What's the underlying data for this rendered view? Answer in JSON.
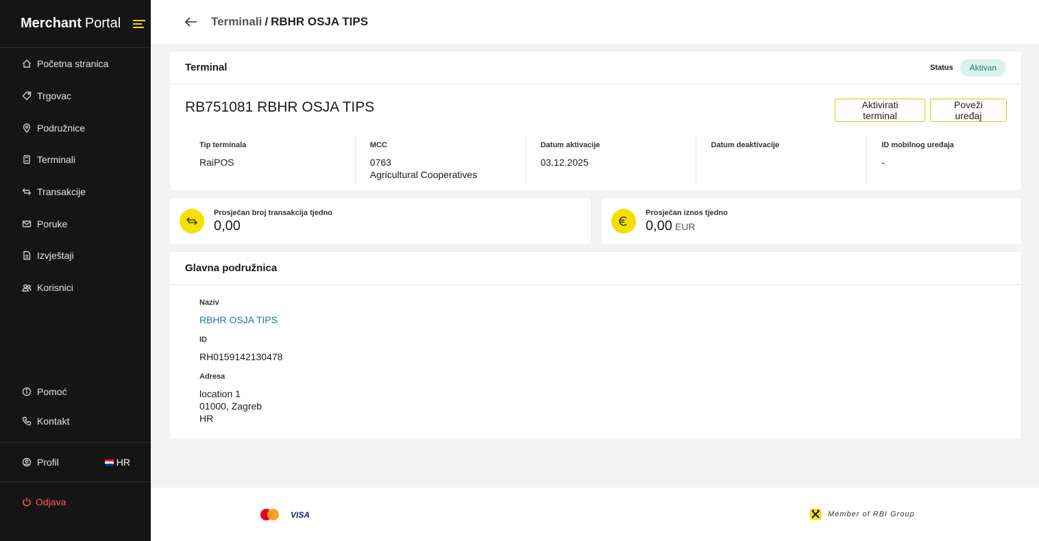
{
  "app": {
    "brand_bold": "Merchant",
    "brand_light": "Portal"
  },
  "sidebar": {
    "items": [
      {
        "label": "Početna stranica",
        "icon": "home-icon"
      },
      {
        "label": "Trgovac",
        "icon": "tag-icon"
      },
      {
        "label": "Podružnice",
        "icon": "location-pin-icon"
      },
      {
        "label": "Terminali",
        "icon": "terminal-icon"
      },
      {
        "label": "Transakcije",
        "icon": "transfer-arrows-icon"
      },
      {
        "label": "Poruke",
        "icon": "mail-icon"
      },
      {
        "label": "Izvještaji",
        "icon": "document-icon"
      },
      {
        "label": "Korisnici",
        "icon": "users-icon"
      }
    ],
    "bottom_items": [
      {
        "label": "Pomoć",
        "icon": "info-icon"
      },
      {
        "label": "Kontakt",
        "icon": "phone-icon"
      }
    ],
    "profile_label": "Profil",
    "language": "HR",
    "logout_label": "Odjava"
  },
  "header": {
    "breadcrumb_link": "Terminali",
    "breadcrumb_sep": "/",
    "breadcrumb_current": "RBHR OSJA TIPS"
  },
  "terminal": {
    "section_title": "Terminal",
    "status_label": "Status",
    "status_value": "Aktivan",
    "title": "RB751081 RBHR OSJA TIPS",
    "activate_button": "Aktivirati terminal",
    "connect_button": "Poveži uređaj",
    "fields": [
      {
        "label": "Tip terminala",
        "value": "RaiPOS",
        "value2": ""
      },
      {
        "label": "MCC",
        "value": "0763",
        "value2": "Agricultural Cooperatives"
      },
      {
        "label": "Datum aktivacije",
        "value": "03.12.2025",
        "value2": ""
      },
      {
        "label": "Datum deaktivacije",
        "value": "",
        "value2": ""
      },
      {
        "label": "ID mobilnog uređaja",
        "value": "-",
        "value2": ""
      }
    ]
  },
  "stats": {
    "transactions_label": "Prosječan broj transakcija tjedno",
    "transactions_value": "0,00",
    "amount_label": "Prosječan iznos tjedno",
    "amount_value": "0,00",
    "amount_unit": "EUR"
  },
  "branch": {
    "section_title": "Glavna podružnica",
    "name_label": "Naziv",
    "name_value": "RBHR OSJA TIPS",
    "id_label": "ID",
    "id_value": "RH0159142130478",
    "address_label": "Adresa",
    "address_lines": [
      "location 1",
      "01000, Zagreb",
      "HR"
    ]
  },
  "footer": {
    "visa_text": "VISA",
    "rbi_text": "Member of RBI Group"
  },
  "colors": {
    "accent": "#f7df00",
    "sidebar_bg": "#151515",
    "link": "#1b7b94",
    "logout": "#ff5a5a",
    "status_bg": "#d9f3ec"
  }
}
